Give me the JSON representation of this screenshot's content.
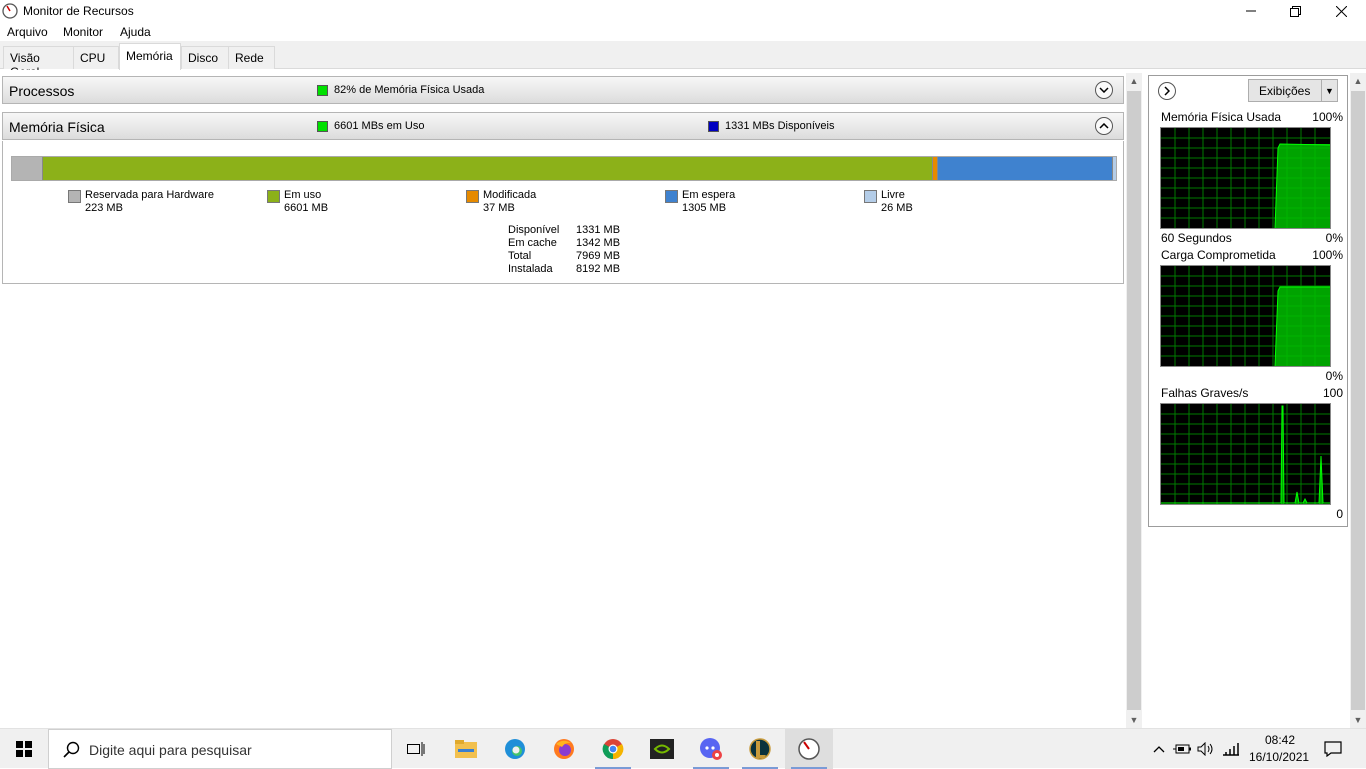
{
  "window": {
    "title": "Monitor de Recursos",
    "controls": {
      "minimize": "minimize-icon",
      "maximize": "maximize-icon",
      "close": "close-icon"
    }
  },
  "menu": [
    "Arquivo",
    "Monitor",
    "Ajuda"
  ],
  "tabs": [
    {
      "label": "Visão Geral",
      "active": false
    },
    {
      "label": "CPU",
      "active": false
    },
    {
      "label": "Memória",
      "active": true
    },
    {
      "label": "Disco",
      "active": false
    },
    {
      "label": "Rede",
      "active": false
    }
  ],
  "sections": {
    "processes": {
      "title": "Processos",
      "info": "82% de Memória Física Usada",
      "info_color": "#00e000",
      "state": "collapsed"
    },
    "physical_memory": {
      "title": "Memória Física",
      "info_used": "6601 MBs em Uso",
      "info_used_color": "#00e000",
      "info_available": "1331 MBs Disponíveis",
      "info_available_color": "#0000c0",
      "state": "expanded",
      "legend": [
        {
          "label": "Reservada para Hardware",
          "value": "223 MB",
          "mb": 223,
          "color": "#b4b4b4"
        },
        {
          "label": "Em uso",
          "value": "6601 MB",
          "mb": 6601,
          "color": "#8cb119"
        },
        {
          "label": "Modificada",
          "value": "37 MB",
          "mb": 37,
          "color": "#e68a00"
        },
        {
          "label": "Em espera",
          "value": "1305 MB",
          "mb": 1305,
          "color": "#3f82cf"
        },
        {
          "label": "Livre",
          "value": "26 MB",
          "mb": 26,
          "color": "#b4cde8"
        }
      ],
      "stats": [
        {
          "label": "Disponível",
          "value": "1331 MB"
        },
        {
          "label": "Em cache",
          "value": "1342 MB"
        },
        {
          "label": "Total",
          "value": "7969 MB"
        },
        {
          "label": "Instalada",
          "value": "8192 MB"
        }
      ]
    }
  },
  "right_panel": {
    "views_label": "Exibições",
    "graphs": [
      {
        "title": "Memória Física Usada",
        "max": "100%",
        "min": "0%",
        "footer": "60 Segundos"
      },
      {
        "title": "Carga Comprometida",
        "max": "100%",
        "min": "0%",
        "footer": ""
      },
      {
        "title": "Falhas Graves/s",
        "max": "100",
        "min": "0",
        "footer": ""
      }
    ]
  },
  "taskbar": {
    "search_placeholder": "Digite aqui para pesquisar",
    "apps": [
      "task-view-icon",
      "file-explorer-icon",
      "edge-icon",
      "firefox-icon",
      "chrome-icon",
      "nvidia-icon",
      "discord-icon",
      "league-icon",
      "resource-monitor-icon"
    ],
    "time": "08:42",
    "date": "16/10/2021"
  }
}
